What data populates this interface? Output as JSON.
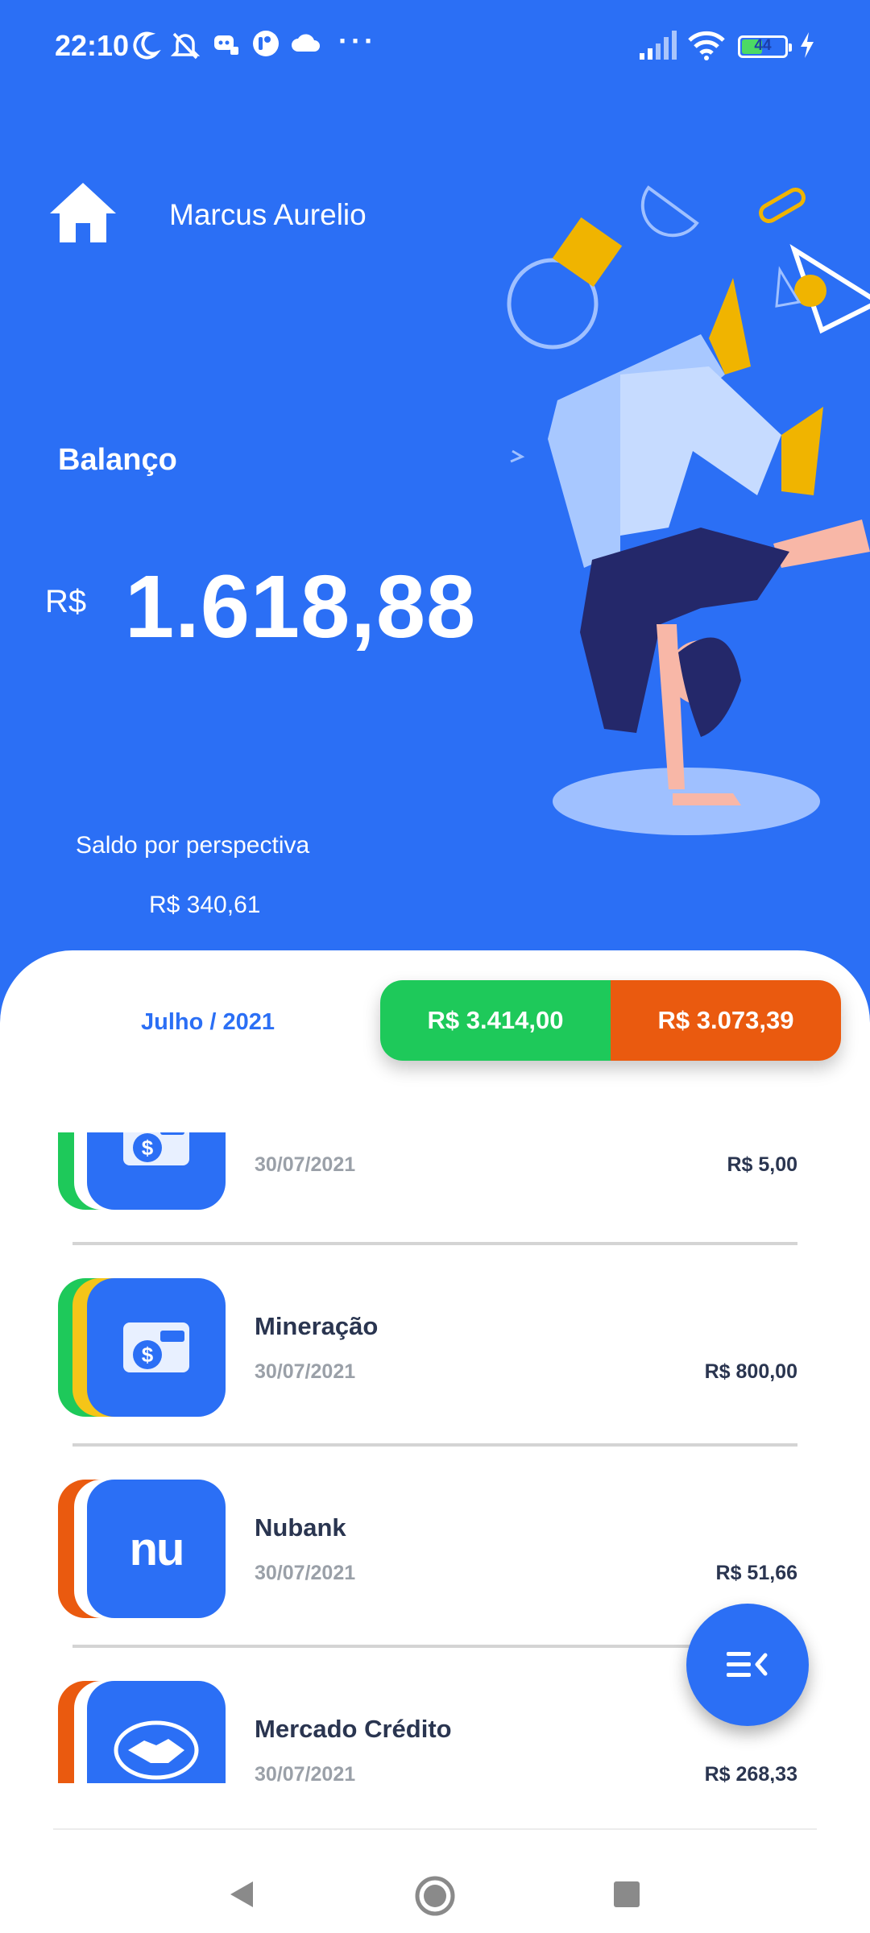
{
  "status_bar": {
    "time": "22:10",
    "dots": "···",
    "battery": "44",
    "icons": [
      "moon-icon",
      "bell-off-icon",
      "discord-icon",
      "app-icon",
      "cloud-icon",
      "signal-icon",
      "wifi-icon",
      "battery-icon",
      "charging-icon"
    ]
  },
  "header": {
    "user_name": "Marcus Aurelio",
    "home_icon": "home-icon"
  },
  "balance": {
    "title": "Balanço",
    "currency": "R$",
    "value": "1.618,88",
    "perspective_label": "Saldo por perspectiva",
    "perspective_value": "R$ 340,61"
  },
  "summary": {
    "month": "Julho / 2021",
    "income": "R$ 3.414,00",
    "expense": "R$ 3.073,39",
    "income_color": "#1ec95a",
    "expense_color": "#ea5a0f"
  },
  "transactions": [
    {
      "name": "",
      "date": "30/07/2021",
      "amount": "R$ 5,00",
      "icon": "wallet-icon",
      "stripes": [
        "#1ec95a"
      ]
    },
    {
      "name": "Mineração",
      "date": "30/07/2021",
      "amount": "R$ 800,00",
      "icon": "wallet-icon",
      "stripes": [
        "#1ec95a",
        "#f5c518"
      ]
    },
    {
      "name": "Nubank",
      "date": "30/07/2021",
      "amount": "R$ 51,66",
      "icon": "nubank-logo-icon",
      "logo_text": "nu",
      "stripes": [
        "#ea5a0f"
      ]
    },
    {
      "name": "Mercado Crédito",
      "date": "30/07/2021",
      "amount": "R$ 268,33",
      "icon": "handshake-icon",
      "stripes": [
        "#ea5a0f"
      ]
    }
  ],
  "fab": {
    "icon": "menu-collapse-icon"
  },
  "colors": {
    "primary": "#2b6ff5",
    "accent_yellow": "#f0b400"
  },
  "nav": {
    "icons": [
      "back-icon",
      "home-circle-icon",
      "recents-icon"
    ]
  }
}
